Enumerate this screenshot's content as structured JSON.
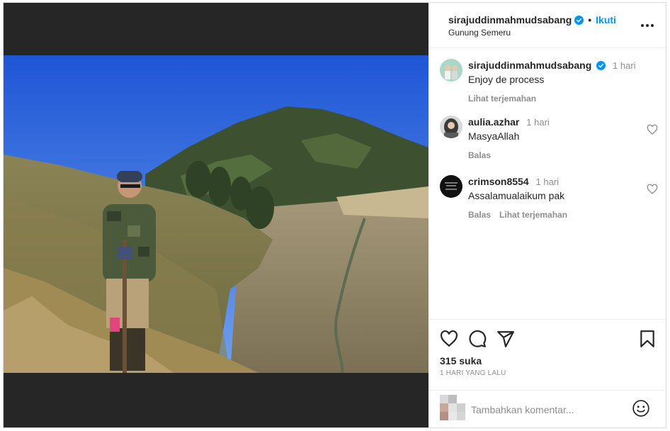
{
  "header": {
    "username": "sirajuddinmahmudsabang",
    "separator": "•",
    "follow_label": "Ikuti",
    "location": "Gunung Semeru",
    "more_icon": "more-horizontal-icon",
    "verified_icon": "verified-badge-icon"
  },
  "caption": {
    "username": "sirajuddinmahmudsabang",
    "time": "1 hari",
    "text": "Enjoy de process",
    "translate": "Lihat terjemahan"
  },
  "comments": [
    {
      "username": "aulia.azhar",
      "time": "1 hari",
      "text": "MasyaAllah",
      "reply": "Balas"
    },
    {
      "username": "crimson8554",
      "time": "1 hari",
      "text": "Assalamualaikum pak",
      "reply": "Balas",
      "translate": "Lihat terjemahan"
    }
  ],
  "actions": {
    "likes": "315 suka",
    "time_ago": "1 HARI YANG LALU",
    "icons": [
      "heart-icon",
      "comment-icon",
      "share-icon",
      "bookmark-icon"
    ]
  },
  "add_comment": {
    "placeholder": "Tambahkan komentar...",
    "emoji_icon": "smiley-icon"
  },
  "colors": {
    "link_blue": "#0095f6",
    "muted": "#8e8e8e",
    "media_bg": "#262626"
  }
}
